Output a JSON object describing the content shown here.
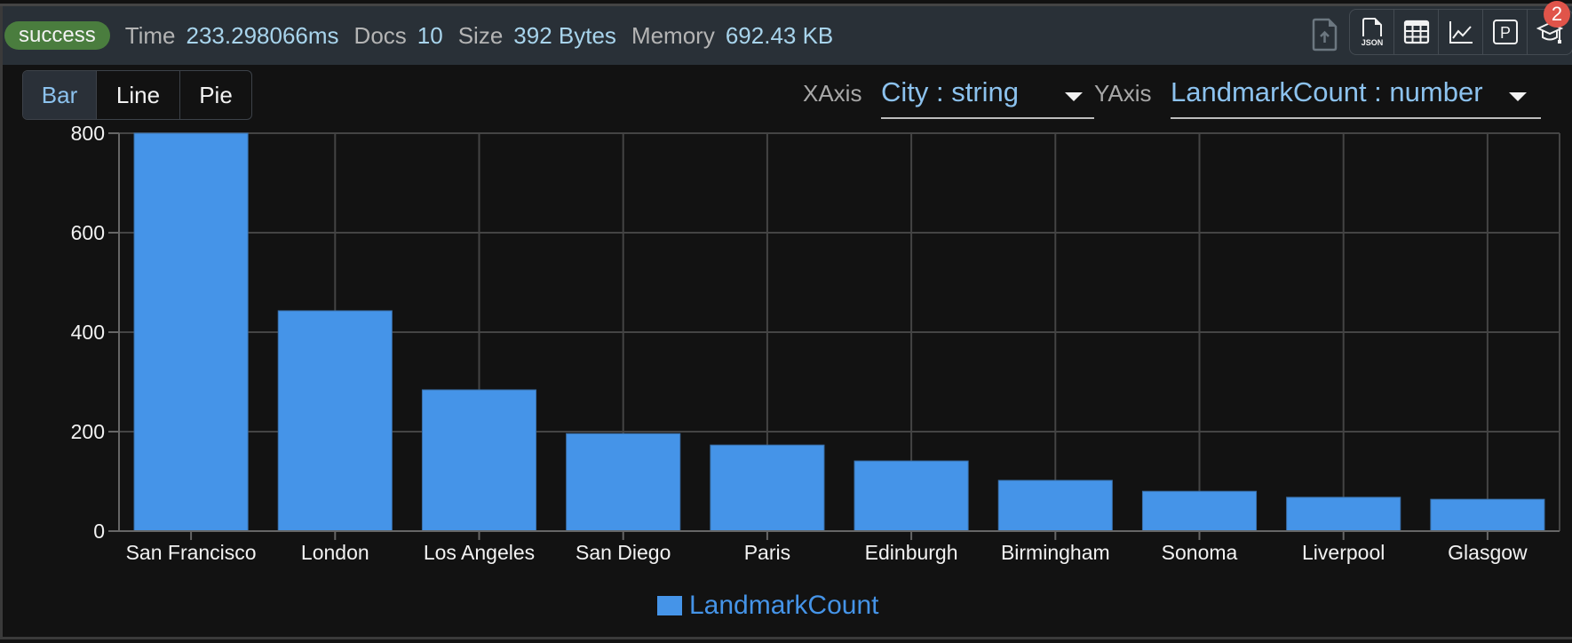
{
  "header": {
    "status": "success",
    "stats": [
      {
        "label": "Time",
        "value": "233.298066ms"
      },
      {
        "label": "Docs",
        "value": "10"
      },
      {
        "label": "Size",
        "value": "392 Bytes"
      },
      {
        "label": "Memory",
        "value": "692.43 KB"
      }
    ],
    "icons": [
      "upload-file-icon",
      "json-file-icon",
      "table-icon",
      "line-chart-icon",
      "parking-p-icon",
      "graduation-cap-icon"
    ],
    "json_icon_text": "JSON",
    "p_icon_text": "P",
    "notification_count": "2"
  },
  "toolbar": {
    "chart_types": [
      {
        "label": "Bar",
        "active": true
      },
      {
        "label": "Line",
        "active": false
      },
      {
        "label": "Pie",
        "active": false
      }
    ],
    "xaxis_label": "XAxis",
    "xaxis_value": "City : string",
    "yaxis_label": "YAxis",
    "yaxis_value": "LandmarkCount : number"
  },
  "colors": {
    "bar": "#4594e8",
    "accent": "#8cc2ee",
    "success": "#4a7d3e",
    "badge": "#e0544a"
  },
  "chart_data": {
    "type": "bar",
    "title": "",
    "xlabel": "",
    "ylabel": "",
    "categories": [
      "San Francisco",
      "London",
      "Los Angeles",
      "San Diego",
      "Paris",
      "Edinburgh",
      "Birmingham",
      "Sonoma",
      "Liverpool",
      "Glasgow"
    ],
    "series": [
      {
        "name": "LandmarkCount",
        "values": [
          800,
          443,
          284,
          196,
          173,
          141,
          102,
          80,
          68,
          64
        ]
      }
    ],
    "ylim": [
      0,
      800
    ],
    "yticks": [
      0,
      200,
      400,
      600,
      800
    ],
    "grid": true,
    "legend": "bottom-center"
  }
}
